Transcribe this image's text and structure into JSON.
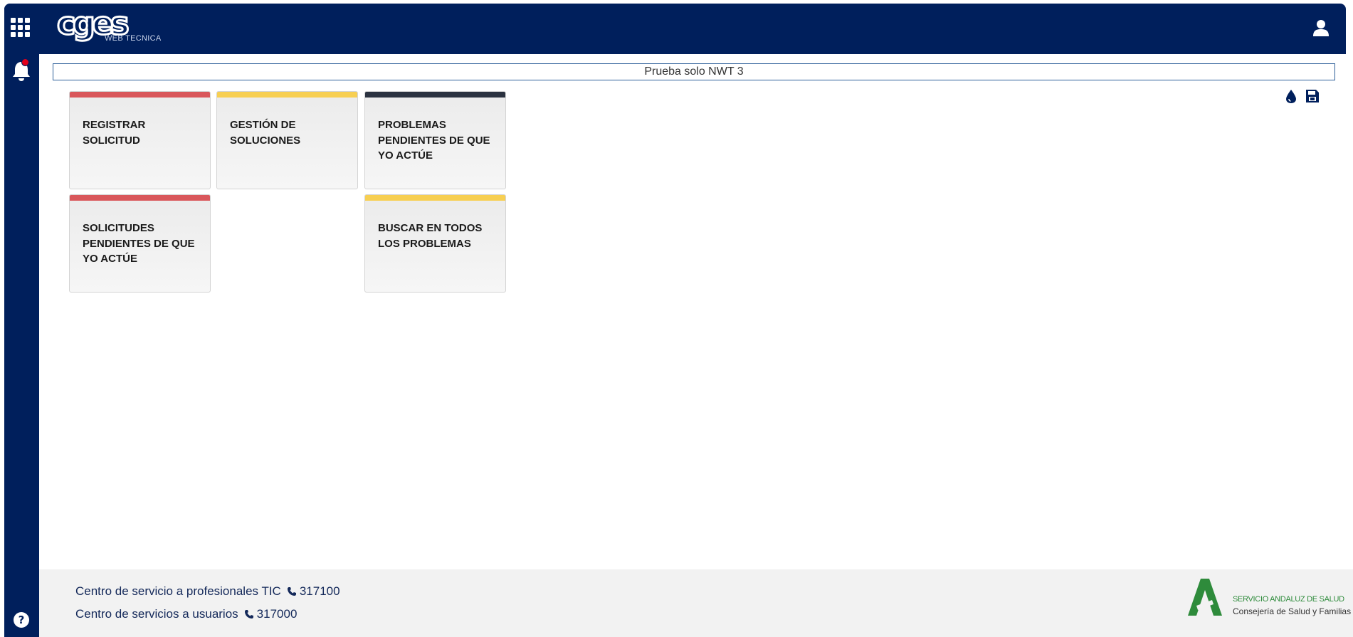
{
  "header": {
    "logo_text": "cges",
    "logo_subtitle": "WEB TECNICA"
  },
  "banner": {
    "text": "Prueba solo NWT 3"
  },
  "tiles": [
    {
      "label": "REGISTRAR SOLICITUD",
      "accent": "#d9575b"
    },
    {
      "label": "GESTIÓN DE SOLUCIONES",
      "accent": "#f7cf52"
    },
    {
      "label": "PROBLEMAS PENDIENTES DE QUE YO ACTÚE",
      "accent": "#2b3240"
    },
    {
      "label": "SOLICITUDES PENDIENTES DE QUE YO ACTÚE",
      "accent": "#d9575b"
    },
    {
      "label": "BUSCAR EN TODOS LOS PROBLEMAS",
      "accent": "#f7cf52"
    }
  ],
  "footer": {
    "contacts": [
      {
        "label": "Centro de servicio a profesionales TIC",
        "phone": "317100"
      },
      {
        "label": "Centro de servicios a usuarios",
        "phone": "317000"
      }
    ],
    "org_line1": "SERVICIO ANDALUZ DE SALUD",
    "org_line2": "Consejería de Salud y Familias"
  },
  "colors": {
    "navy": "#001f5c",
    "notification": "#e2001a",
    "sas_green": "#2e8b3b"
  },
  "icons": {
    "apps": "grid-icon",
    "user": "user-icon",
    "notifications": "bell-icon",
    "help": "help-icon",
    "theme": "droplet-icon",
    "save": "save-icon",
    "phone": "phone-icon"
  }
}
